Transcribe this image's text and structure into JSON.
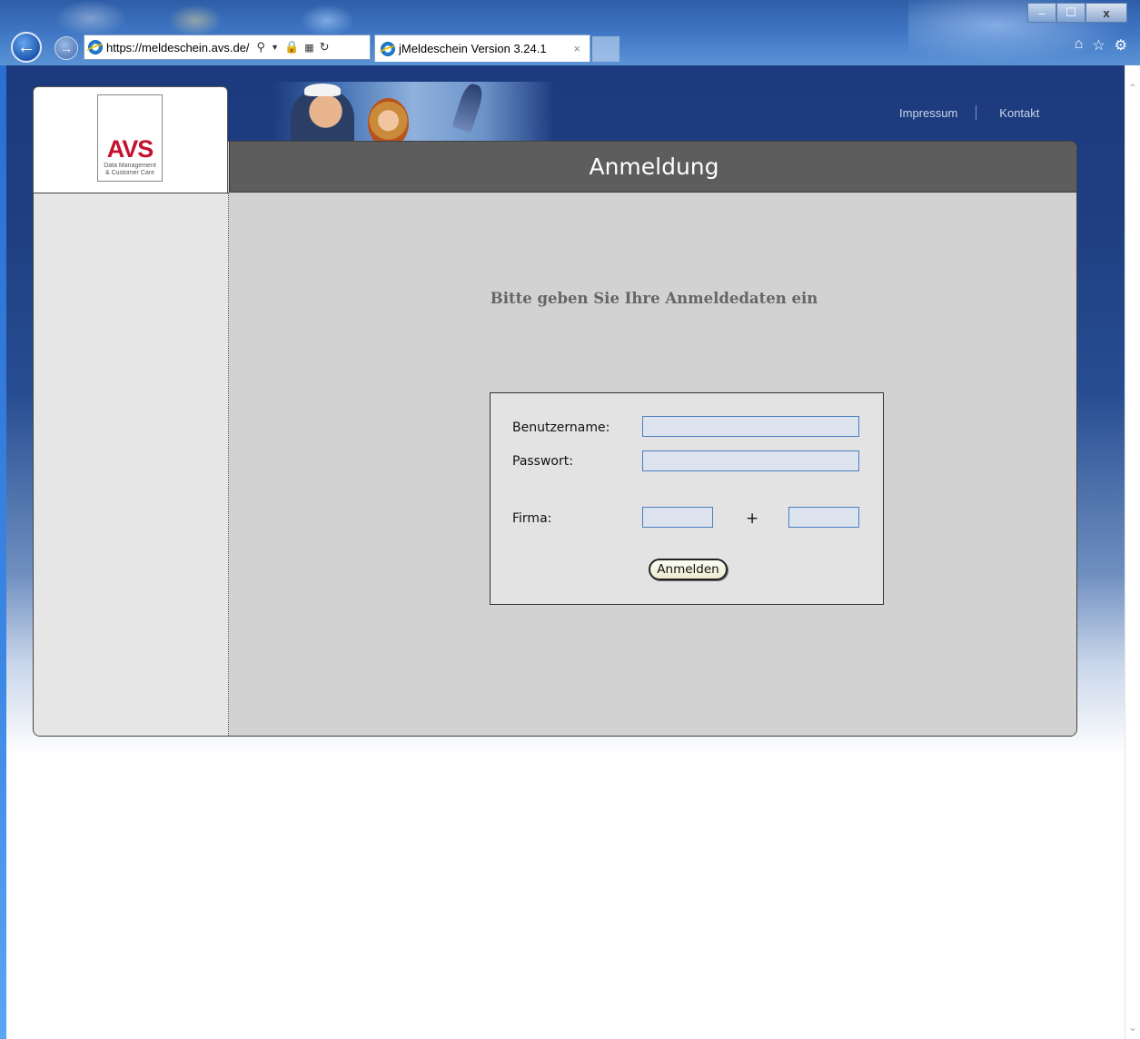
{
  "browser": {
    "url_scheme": "https://",
    "url_host": "meldeschein.avs.de/",
    "tab_title": "jMeldeschein Version 3.24.1",
    "tab_close": "×",
    "window_controls": {
      "minimize": "–",
      "maximize": "☐",
      "close": "x"
    }
  },
  "site": {
    "logo": {
      "word": "AVS",
      "line1": "Data Management",
      "line2": "& Customer Care"
    },
    "toplinks": [
      "Impressum",
      "Kontakt"
    ],
    "page_title": "Anmeldung",
    "prompt": "Bitte geben Sie Ihre Anmeldedaten ein"
  },
  "form": {
    "username_label": "Benutzername:",
    "username_value": "",
    "password_label": "Passwort:",
    "password_value": "",
    "company_label": "Firma:",
    "company_value_1": "",
    "company_value_2": "",
    "plus": "+",
    "submit_label": "Anmelden"
  },
  "colors": {
    "brand_red": "#c4122f",
    "header_bar": "#5d5d5d",
    "content_bg": "#d2d2d2",
    "field_border": "#4a7fc1"
  }
}
